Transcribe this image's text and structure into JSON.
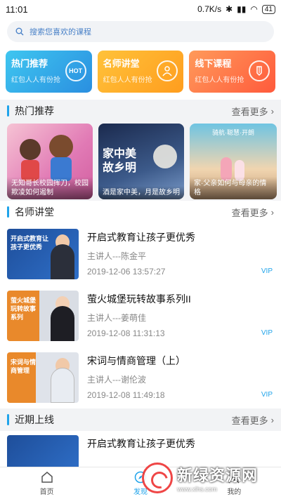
{
  "status_bar": {
    "time": "11:01",
    "network_speed": "0.7K/s",
    "battery": "41"
  },
  "search": {
    "placeholder": "搜索您喜欢的课程"
  },
  "categories": [
    {
      "title": "热门推荐",
      "subtitle": "红包人人有份抢",
      "icon": "hot-icon",
      "icon_text": "HOT"
    },
    {
      "title": "名师讲堂",
      "subtitle": "红包人人有份抢",
      "icon": "teacher-icon",
      "icon_text": ""
    },
    {
      "title": "线下课程",
      "subtitle": "红包人人有份抢",
      "icon": "pencil-icon",
      "icon_text": ""
    }
  ],
  "hot_section": {
    "title": "热门推荐",
    "more": "查看更多",
    "cards": [
      {
        "caption": "无知哥长校园挥刀，校园欺凌如何遏制"
      },
      {
        "caption": "酒是家中美，月是故乡明",
        "overlay": "家中美\n故乡明"
      },
      {
        "caption": "家·父亲如何与母亲的情格",
        "tag": "骑航·聪慧·开朗"
      }
    ]
  },
  "teacher_section": {
    "title": "名师讲堂",
    "more": "查看更多",
    "items": [
      {
        "title": "开启式教育让孩子更优秀",
        "speaker": "主讲人---陈金平",
        "time": "2019-12-06 13:57:27",
        "badge": "VIP",
        "thumb_text": "开启式教育让孩子更优秀"
      },
      {
        "title": "萤火城堡玩转故事系列II",
        "speaker": "主讲人---姜萌佳",
        "time": "2019-12-08 11:31:13",
        "badge": "VIP",
        "thumb_text": "萤火城堡玩转故事系列"
      },
      {
        "title": "宋词与情商管理（上）",
        "speaker": "主讲人---谢伦波",
        "time": "2019-12-08 11:49:18",
        "badge": "VIP",
        "thumb_text": "宋词与情商管理"
      }
    ]
  },
  "recent_section": {
    "title": "近期上线",
    "more": "查看更多",
    "items": [
      {
        "title": "开启式教育让孩子更优秀"
      }
    ]
  },
  "tabbar": [
    {
      "label": "首页",
      "icon": "home-icon",
      "active": false
    },
    {
      "label": "发现",
      "icon": "discover-icon",
      "active": true
    },
    {
      "label": "我的",
      "icon": "profile-icon",
      "active": false
    }
  ],
  "watermark": {
    "title": "新绿资源网",
    "url": "www.xlhs.com"
  },
  "colors": {
    "accent": "#1fa3ea",
    "hot_card": "#2a8fe0",
    "teacher_card": "#ff9d1e",
    "offline_card": "#ff5a3c"
  }
}
